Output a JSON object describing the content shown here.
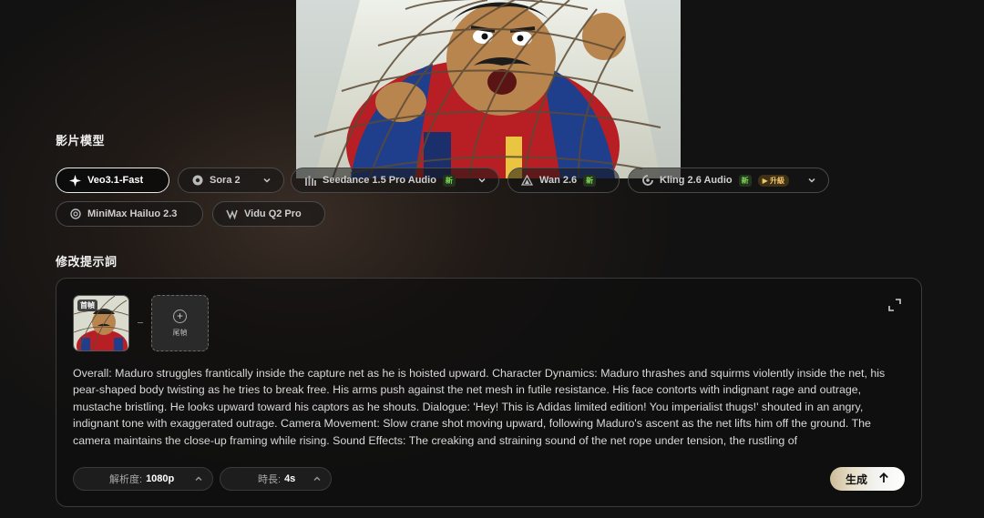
{
  "sections": {
    "model_label": "影片模型",
    "prompt_label": "修改提示詞"
  },
  "models": [
    {
      "label": "Veo3.1-Fast",
      "icon": "sparkle-icon",
      "selected": true
    },
    {
      "label": "Sora 2",
      "icon": "sora-logo-icon"
    },
    {
      "label": "Seedance 1.5 Pro Audio",
      "icon": "seedance-logo-icon",
      "badge": "新"
    },
    {
      "label": "Wan 2.6",
      "icon": "wan-logo-icon",
      "badge": "新"
    },
    {
      "label": "Kling 2.6 Audio",
      "icon": "kling-logo-icon",
      "badge": "新",
      "badge2": "▶ 升級"
    },
    {
      "label": "MiniMax Hailuo 2.3",
      "icon": "minimax-logo-icon"
    },
    {
      "label": "Vidu Q2 Pro",
      "icon": "vidu-logo-icon"
    }
  ],
  "prompt_card": {
    "first_frame_tag": "首幀",
    "end_frame_label": "尾幀",
    "prompt_text": "Overall: Maduro struggles frantically inside the capture net as he is hoisted upward. Character Dynamics: Maduro thrashes and squirms violently inside the net, his pear-shaped body twisting as he tries to break free. His arms push against the net mesh in futile resistance. His face contorts with indignant rage and outrage, mustache bristling. He looks upward toward his captors as he shouts. Dialogue: 'Hey! This is Adidas limited edition! You imperialist thugs!' shouted in an angry, indignant tone with exaggerated outrage. Camera Movement: Slow crane shot moving upward, following Maduro's ascent as the net lifts him off the ground. The camera maintains the close-up framing while rising. Sound Effects: The creaking and straining sound of the net rope under tension, the rustling of",
    "resolution_label": "解析度:",
    "resolution_value": "1080p",
    "duration_label": "時長:",
    "duration_value": "4s",
    "generate_label": "生成"
  },
  "colors": {
    "accent_new": "#7ed957",
    "upgrade": "#f3c46a",
    "background": "#121212"
  }
}
